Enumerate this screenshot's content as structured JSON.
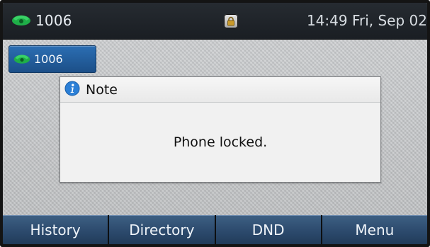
{
  "status_bar": {
    "account_label": "1006",
    "account_icon": "phone-handset-icon",
    "lock_icon": "padlock-icon",
    "datetime": "14:49 Fri, Sep 02"
  },
  "line_key": {
    "label": "1006",
    "icon": "phone-handset-icon"
  },
  "dialog": {
    "title": "Note",
    "icon": "info-icon",
    "message": "Phone locked."
  },
  "softkeys": [
    {
      "label": "History"
    },
    {
      "label": "Directory"
    },
    {
      "label": "DND"
    },
    {
      "label": "Menu"
    }
  ],
  "colors": {
    "accent_green": "#21b34a",
    "line_key_blue": "#2b6eb3",
    "info_blue": "#2b7fd6"
  }
}
